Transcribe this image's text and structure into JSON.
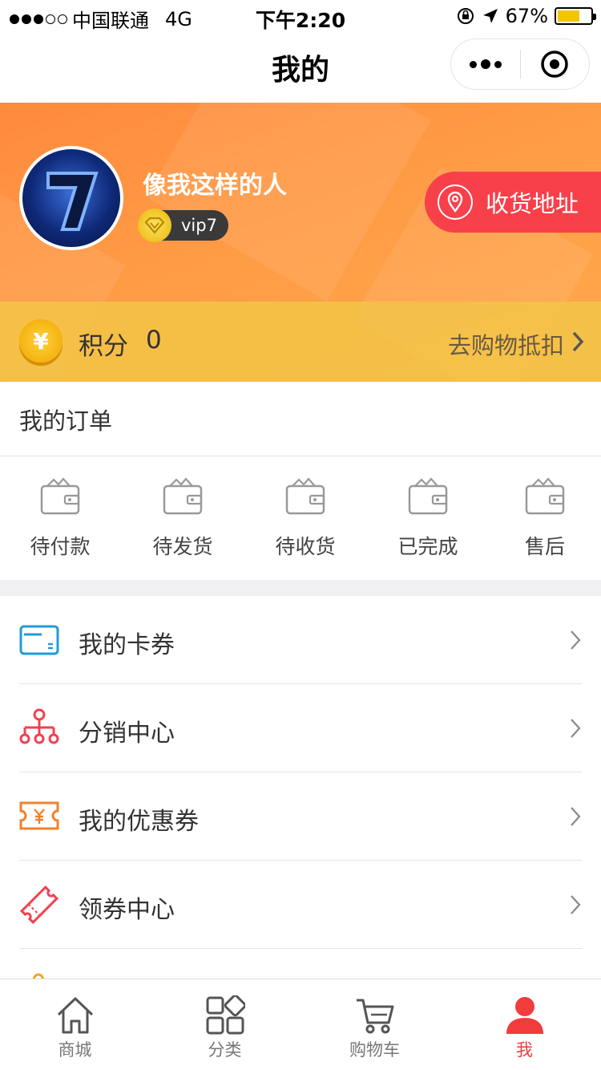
{
  "status_bar": {
    "carrier": "中国联通",
    "network": "4G",
    "time": "下午2:20",
    "battery": "67%"
  },
  "nav": {
    "title": "我的"
  },
  "profile": {
    "username": "像我这样的人",
    "vip_level": "vip7",
    "address_button": "收货地址",
    "points_label": "积分",
    "points_value": "0",
    "points_link": "去购物抵扣"
  },
  "orders": {
    "title": "我的订单",
    "items": [
      {
        "label": "待付款"
      },
      {
        "label": "待发货"
      },
      {
        "label": "待收货"
      },
      {
        "label": "已完成"
      },
      {
        "label": "售后"
      }
    ]
  },
  "menu": {
    "items": [
      {
        "label": "我的卡券",
        "icon": "card-icon"
      },
      {
        "label": "分销中心",
        "icon": "distribution-icon"
      },
      {
        "label": "我的优惠券",
        "icon": "coupon-icon"
      },
      {
        "label": "领券中心",
        "icon": "ticket-icon"
      }
    ]
  },
  "tab_bar": {
    "items": [
      {
        "label": "商城",
        "icon": "home-icon"
      },
      {
        "label": "分类",
        "icon": "category-icon"
      },
      {
        "label": "购物车",
        "icon": "cart-icon"
      },
      {
        "label": "我",
        "icon": "user-icon",
        "active": true
      }
    ]
  },
  "colors": {
    "accent": "#f23b3b",
    "header_orange": "#ff9b45",
    "points_bar": "#f3c446"
  }
}
